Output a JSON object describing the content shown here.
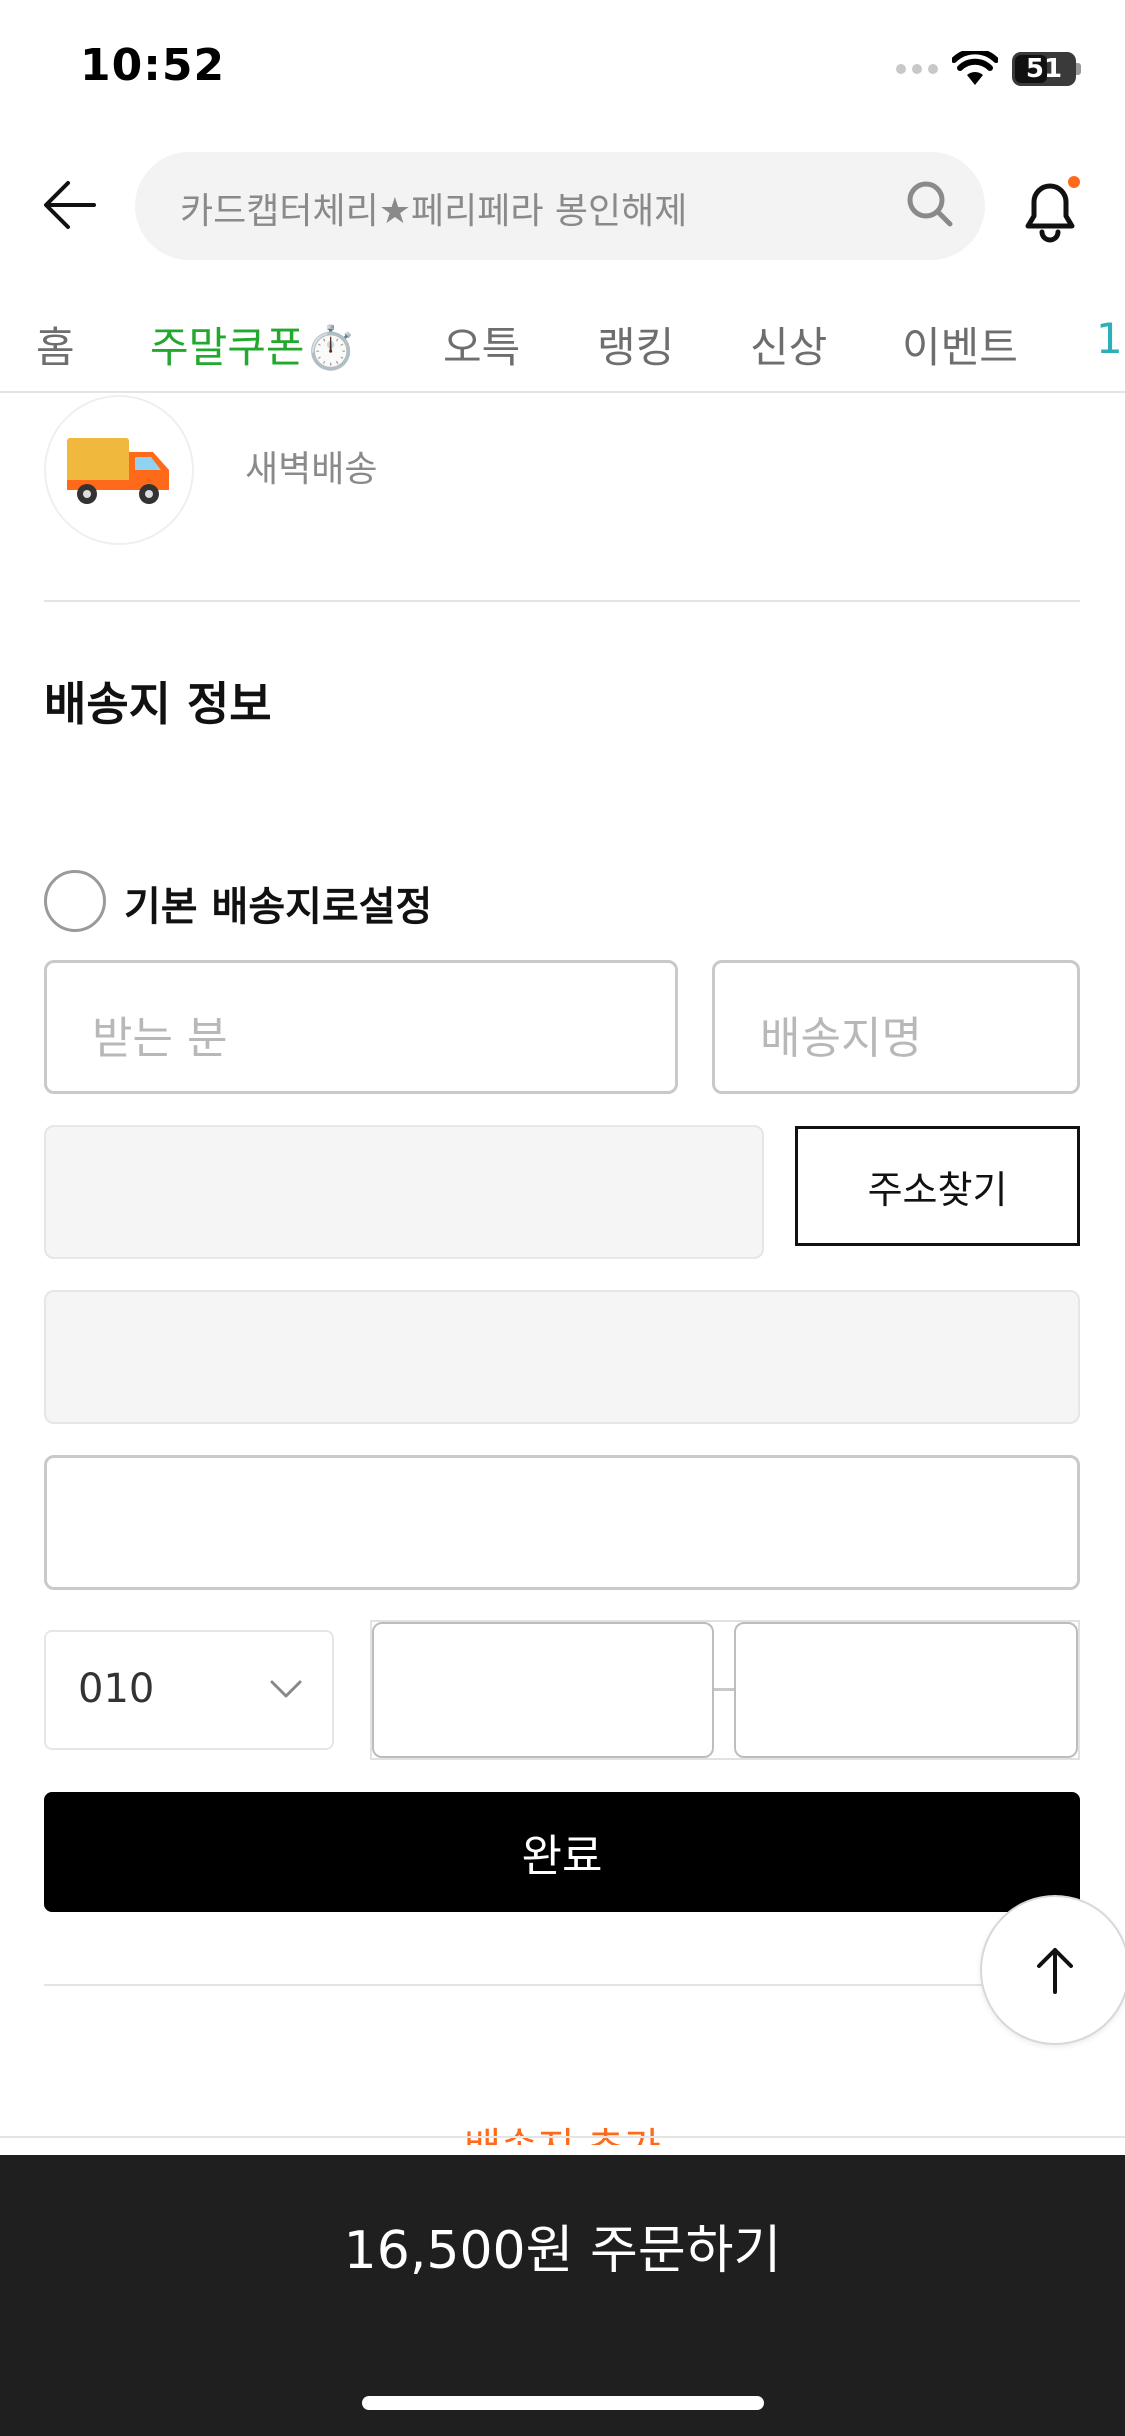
{
  "status_bar": {
    "time": "10:52",
    "battery": "51",
    "icons": [
      "signal-dots-icon",
      "wifi-icon",
      "battery-icon"
    ]
  },
  "header": {
    "search_text": "카드캡터체리★페리페라 봉인해제",
    "icons": [
      "back-arrow-icon",
      "search-icon",
      "bell-icon"
    ]
  },
  "tabs": [
    {
      "label": "홈",
      "active": false
    },
    {
      "label": "주말쿠폰⏱️",
      "active": true
    },
    {
      "label": "오특",
      "active": false
    },
    {
      "label": "랭킹",
      "active": false
    },
    {
      "label": "신상",
      "active": false
    },
    {
      "label": "이벤트",
      "active": false
    },
    {
      "label": "1",
      "active": false
    }
  ],
  "delivery": {
    "label": "새벽배송",
    "icon": "delivery-truck-icon"
  },
  "shipping_info": {
    "title": "배송지 정보",
    "default_label": "기본 배송지로설정",
    "recipient_placeholder": "받는 분",
    "address_name_placeholder": "배송지명",
    "address_search_button": "주소찾기",
    "phone_prefix": "010",
    "done_button": "완료",
    "add_address_link": "배송지 추가"
  },
  "order": {
    "button_label": "16,500원 주문하기"
  },
  "colors": {
    "accent_green": "#22a82c",
    "accent_orange": "#ff6a1a",
    "order_bar": "#1f1f1f"
  }
}
